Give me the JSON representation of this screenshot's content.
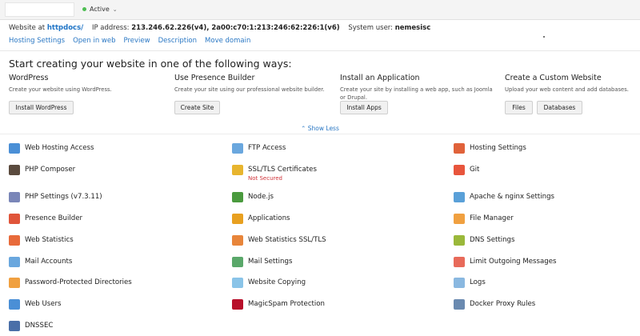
{
  "header": {
    "status": "Active",
    "info_prefix": "Website at",
    "folder": "httpdocs/",
    "ip_label": "IP address:",
    "ip_value": "213.246.62.226(v4), 2a00:c70:1:213:246:62:226:1(v6)",
    "user_label": "System user:",
    "user_value": "nemesisc",
    "links": [
      "Hosting Settings",
      "Open in web",
      "Preview",
      "Description",
      "Move domain"
    ]
  },
  "create": {
    "heading": "Start creating your website in one of the following ways:",
    "options": [
      {
        "title": "WordPress",
        "desc": "Create your website using WordPress.",
        "buttons": [
          "Install WordPress"
        ]
      },
      {
        "title": "Use Presence Builder",
        "desc": "Create your site using our professional website builder.",
        "buttons": [
          "Create Site"
        ]
      },
      {
        "title": "Install an Application",
        "desc": "Create your site by installing a web app, such as Joomla or Drupal.",
        "buttons": [
          "Install Apps"
        ]
      },
      {
        "title": "Create a Custom Website",
        "desc": "Upload your web content and add databases.",
        "buttons": [
          "Files",
          "Databases"
        ]
      }
    ],
    "show_less": "⌃ Show Less"
  },
  "tools": [
    {
      "label": "Web Hosting Access",
      "icon": "user-globe-icon",
      "color": "#4a8fd6"
    },
    {
      "label": "FTP Access",
      "icon": "ftp-monitor-icon",
      "color": "#6aa7de"
    },
    {
      "label": "Hosting Settings",
      "icon": "hosting-doc-icon",
      "color": "#e0623a"
    },
    {
      "label": "PHP Composer",
      "icon": "composer-icon",
      "color": "#5a4a3e"
    },
    {
      "label": "SSL/TLS Certificates",
      "sub": "Not Secured",
      "icon": "lock-icon",
      "color": "#e8b52e"
    },
    {
      "label": "Git",
      "icon": "git-icon",
      "color": "#e8553c"
    },
    {
      "label": "PHP Settings (v7.3.11)",
      "icon": "php-icon",
      "color": "#7a86b8"
    },
    {
      "label": "Node.js",
      "icon": "nodejs-icon",
      "color": "#4a9a3e"
    },
    {
      "label": "Apache & nginx Settings",
      "icon": "server-settings-icon",
      "color": "#5aa0d8"
    },
    {
      "label": "Presence Builder",
      "icon": "builder-tools-icon",
      "color": "#e0553a"
    },
    {
      "label": "Applications",
      "icon": "applications-gear-icon",
      "color": "#e8a020"
    },
    {
      "label": "File Manager",
      "icon": "folder-icon",
      "color": "#f0a040"
    },
    {
      "label": "Web Statistics",
      "icon": "statistics-chart-icon",
      "color": "#e86a3a"
    },
    {
      "label": "Web Statistics SSL/TLS",
      "icon": "statistics-ssl-icon",
      "color": "#e8853a"
    },
    {
      "label": "DNS Settings",
      "icon": "dns-icon",
      "color": "#9ab83a"
    },
    {
      "label": "Mail Accounts",
      "icon": "mail-icon",
      "color": "#6aa7de"
    },
    {
      "label": "Mail Settings",
      "icon": "mail-settings-icon",
      "color": "#5aa86a"
    },
    {
      "label": "Limit Outgoing Messages",
      "icon": "mail-limit-icon",
      "color": "#e86a5a"
    },
    {
      "label": "Password-Protected Directories",
      "icon": "protected-folder-icon",
      "color": "#f0a040"
    },
    {
      "label": "Website Copying",
      "icon": "copy-icon",
      "color": "#8ac4e8"
    },
    {
      "label": "Logs",
      "icon": "logs-icon",
      "color": "#8ab8e0"
    },
    {
      "label": "Web Users",
      "icon": "web-users-icon",
      "color": "#4a8fd6"
    },
    {
      "label": "MagicSpam Protection",
      "icon": "magicspam-icon",
      "color": "#b8102a"
    },
    {
      "label": "Docker Proxy Rules",
      "icon": "docker-icon",
      "color": "#6a8ab0"
    },
    {
      "label": "DNSSEC",
      "icon": "dnssec-icon",
      "color": "#4a6fa8"
    }
  ]
}
